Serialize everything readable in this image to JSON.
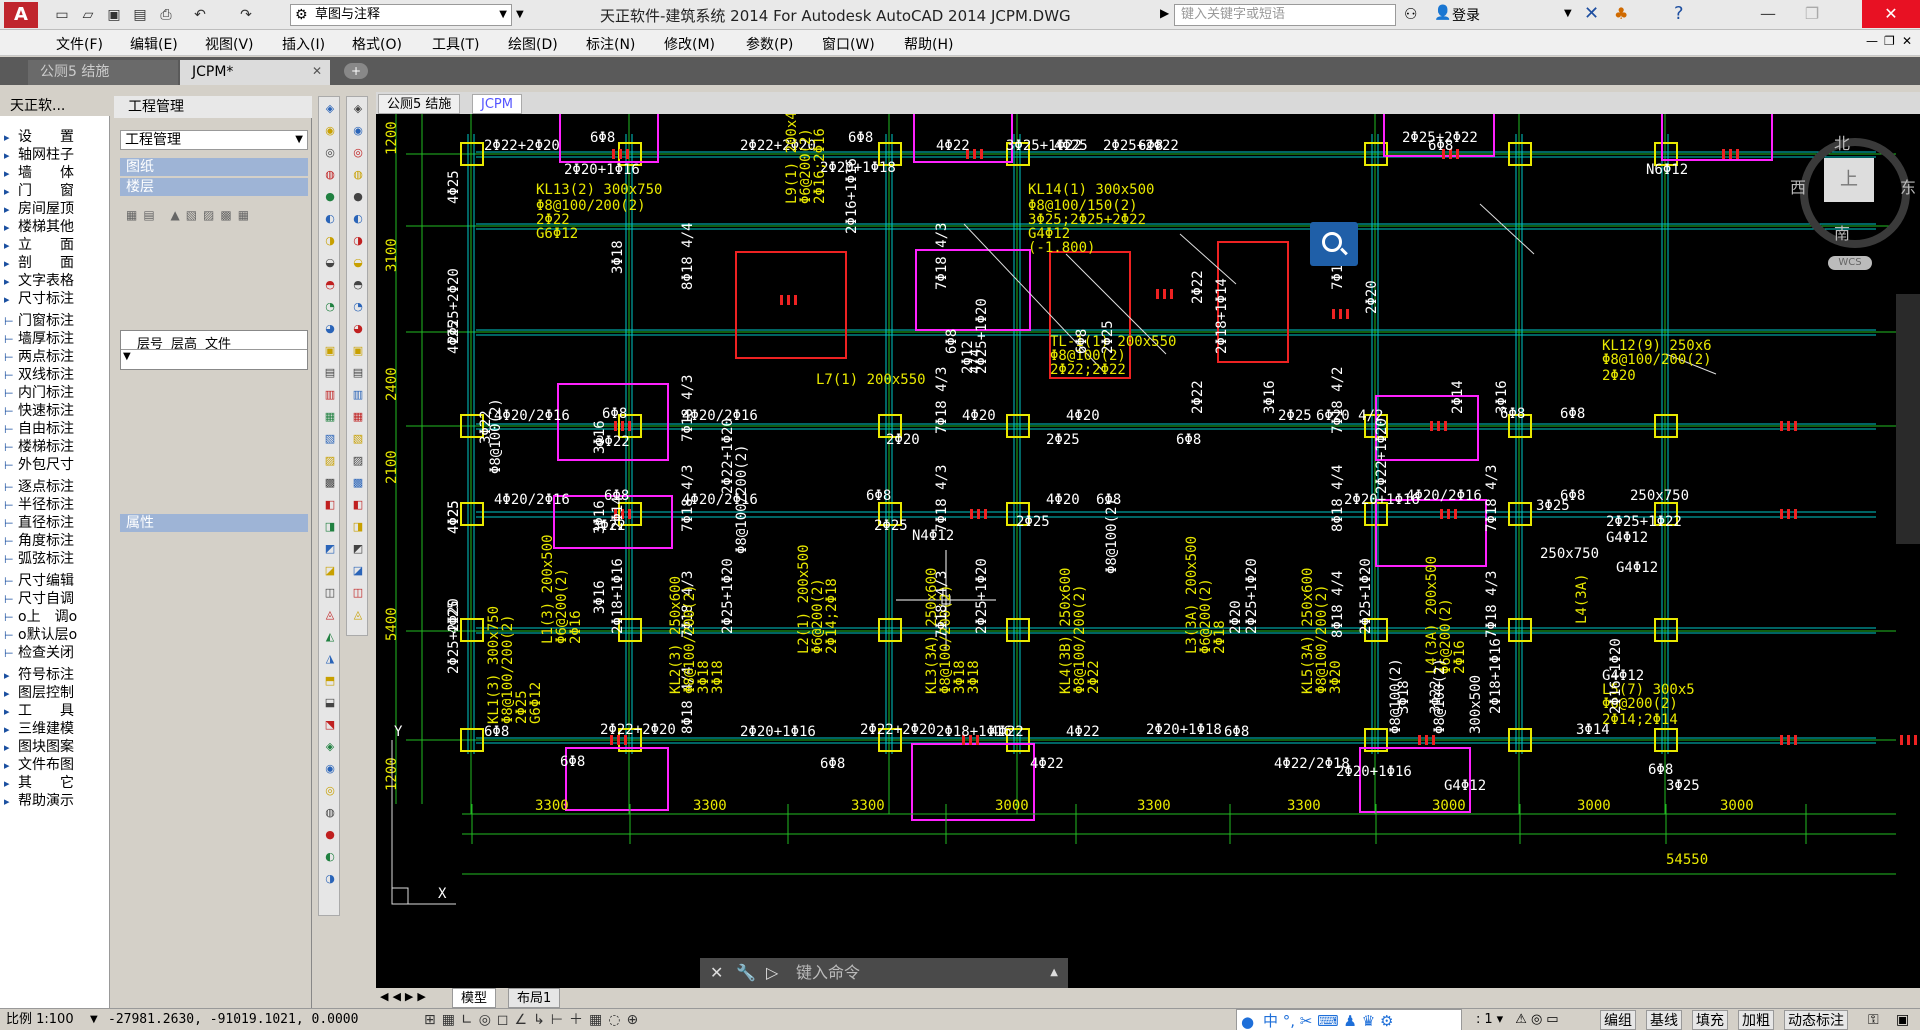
{
  "app": {
    "title": "天正软件-建筑系统 2014  For Autodesk AutoCAD 2014    JCPM.DWG",
    "logo": "A",
    "workspace": "草图与注释",
    "search_placeholder": "键入关键字或短语",
    "login": "登录"
  },
  "menu": [
    "文件(F)",
    "编辑(E)",
    "视图(V)",
    "插入(I)",
    "格式(O)",
    "工具(T)",
    "绘图(D)",
    "标注(N)",
    "修改(M)",
    "参数(P)",
    "窗口(W)",
    "帮助(H)"
  ],
  "file_tabs": [
    "公厕5 结施",
    "JCPM*"
  ],
  "left_panel": {
    "title": "天正软...",
    "items": [
      "设　　置",
      "轴网柱子",
      "墙　　体",
      "门　　窗",
      "房间屋顶",
      "楼梯其他",
      "立　　面",
      "剖　　面",
      "文字表格",
      "尺寸标注",
      "门窗标注",
      "墙厚标注",
      "两点标注",
      "双线标注",
      "内门标注",
      "快速标注",
      "自由标注",
      "楼梯标注",
      "外包尺寸",
      "逐点标注",
      "半径标注",
      "直径标注",
      "角度标注",
      "弧弦标注",
      "尺寸编辑",
      "尺寸自调",
      "o上　调o",
      "o默认层o",
      "检查关闭",
      "符号标注",
      "图层控制",
      "工　　具",
      "三维建模",
      "图块图案",
      "文件布图",
      "其　　它",
      "帮助演示"
    ]
  },
  "project_panel": {
    "title": "工程管理",
    "select": "工程管理",
    "sections": [
      "图纸",
      "楼层",
      "属性"
    ],
    "table_headers": [
      "层号",
      "层高",
      "文件"
    ]
  },
  "drawing_tabs": [
    "公厕5 结施",
    "JCPM"
  ],
  "compass": {
    "north": "北",
    "south": "南",
    "east": "东",
    "west": "西",
    "top": "上",
    "wcs": "WCS"
  },
  "axis": {
    "x": "X",
    "y": "Y"
  },
  "dims_bottom": [
    "3300",
    "3300",
    "3300",
    "3000",
    "3300",
    "3300",
    "3000",
    "3000",
    "3000"
  ],
  "dim_total": "54550",
  "dims_left": [
    "1200",
    "3100",
    "2400",
    "2100",
    "5400",
    "1200"
  ],
  "labels": [
    {
      "t": "2Φ22+2Φ20",
      "k": "w"
    },
    {
      "t": "6Φ8",
      "k": "w"
    },
    {
      "t": "2Φ20+1Φ16",
      "k": "w"
    },
    {
      "t": "2Φ22+2Φ20",
      "k": "w"
    },
    {
      "t": "6Φ8",
      "k": "w"
    },
    {
      "t": "2Φ20+1Φ18",
      "k": "w"
    },
    {
      "t": "4Φ22",
      "k": "w"
    },
    {
      "t": "3Φ25+1Φ22",
      "k": "w"
    },
    {
      "t": "4Φ25",
      "k": "w"
    },
    {
      "t": "2Φ25+2Φ22",
      "k": "w"
    },
    {
      "t": "6Φ8",
      "k": "w"
    },
    {
      "t": "2Φ25+2Φ22",
      "k": "w"
    },
    {
      "t": "6Φ8",
      "k": "w"
    },
    {
      "t": "N6Φ12",
      "k": "w"
    },
    {
      "t": "KL13(2) 300x750",
      "k": "y"
    },
    {
      "t": "Φ8@100/200(2)",
      "k": "y"
    },
    {
      "t": "2Φ22",
      "k": "y"
    },
    {
      "t": "G6Φ12",
      "k": "y"
    },
    {
      "t": "KL14(1) 300x500",
      "k": "y"
    },
    {
      "t": "Φ8@100/150(2)",
      "k": "y"
    },
    {
      "t": "3Φ25;2Φ25+2Φ22",
      "k": "y"
    },
    {
      "t": "G4Φ12",
      "k": "y"
    },
    {
      "t": "(-1.800)",
      "k": "y"
    },
    {
      "t": "L7(1) 200x550",
      "k": "y"
    },
    {
      "t": "TL-1(1) 200x550",
      "k": "y"
    },
    {
      "t": "Φ8@100(2)",
      "k": "y"
    },
    {
      "t": "2Φ22;2Φ22",
      "k": "y"
    },
    {
      "t": "KL12(9) 250x6",
      "k": "y"
    },
    {
      "t": "Φ8@100/200(2)",
      "k": "y"
    },
    {
      "t": "2Φ20",
      "k": "y"
    },
    {
      "t": "4Φ20/2Φ16",
      "k": "w"
    },
    {
      "t": "6Φ8",
      "k": "w"
    },
    {
      "t": "3Φ22",
      "k": "w"
    },
    {
      "t": "4Φ20/2Φ16",
      "k": "w"
    },
    {
      "t": "2Φ20",
      "k": "w"
    },
    {
      "t": "4Φ20",
      "k": "w"
    },
    {
      "t": "2Φ25",
      "k": "w"
    },
    {
      "t": "4Φ20",
      "k": "w"
    },
    {
      "t": "6Φ8",
      "k": "w"
    },
    {
      "t": "2Φ25",
      "k": "w"
    },
    {
      "t": "6Φ20 4/2",
      "k": "w"
    },
    {
      "t": "6Φ8",
      "k": "w"
    },
    {
      "t": "6Φ8",
      "k": "w"
    },
    {
      "t": "4Φ20/2Φ16",
      "k": "w"
    },
    {
      "t": "6Φ8",
      "k": "w"
    },
    {
      "t": "3Φ22",
      "k": "w"
    },
    {
      "t": "4Φ20/2Φ16",
      "k": "w"
    },
    {
      "t": "6Φ8",
      "k": "w"
    },
    {
      "t": "2Φ25",
      "k": "w"
    },
    {
      "t": "N4Φ12",
      "k": "w"
    },
    {
      "t": "2Φ25",
      "k": "w"
    },
    {
      "t": "4Φ20",
      "k": "w"
    },
    {
      "t": "6Φ8",
      "k": "w"
    },
    {
      "t": "2Φ20+1Φ16",
      "k": "w"
    },
    {
      "t": "4Φ20/2Φ16",
      "k": "w"
    },
    {
      "t": "6Φ8",
      "k": "w"
    },
    {
      "t": "2Φ25+1Φ22",
      "k": "w"
    },
    {
      "t": "G4Φ12",
      "k": "w"
    },
    {
      "t": "250x750",
      "k": "w"
    },
    {
      "t": "3Φ25",
      "k": "w"
    },
    {
      "t": "G4Φ12",
      "k": "w"
    },
    {
      "t": "250x750",
      "k": "w"
    },
    {
      "t": "6Φ8",
      "k": "w"
    },
    {
      "t": "2Φ22+2Φ20",
      "k": "w"
    },
    {
      "t": "6Φ8",
      "k": "w"
    },
    {
      "t": "2Φ20+1Φ16",
      "k": "w"
    },
    {
      "t": "2Φ22+2Φ20",
      "k": "w"
    },
    {
      "t": "6Φ8",
      "k": "w"
    },
    {
      "t": "2Φ18+1Φ16",
      "k": "w"
    },
    {
      "t": "4Φ22",
      "k": "w"
    },
    {
      "t": "4Φ22",
      "k": "w"
    },
    {
      "t": "4Φ22",
      "k": "w"
    },
    {
      "t": "2Φ20+1Φ18",
      "k": "w"
    },
    {
      "t": "6Φ8",
      "k": "w"
    },
    {
      "t": "4Φ22/2Φ18",
      "k": "w"
    },
    {
      "t": "2Φ20+1Φ16",
      "k": "w"
    },
    {
      "t": "G4Φ12",
      "k": "w"
    },
    {
      "t": "3Φ14",
      "k": "w"
    },
    {
      "t": "6Φ8",
      "k": "w"
    },
    {
      "t": "3Φ25",
      "k": "w"
    },
    {
      "t": "G4Φ12",
      "k": "w"
    },
    {
      "t": "L5(7) 300x5",
      "k": "y"
    },
    {
      "t": "Φ6@200(2)",
      "k": "y"
    },
    {
      "t": "2Φ14;2Φ14",
      "k": "y"
    },
    {
      "t": "G4Φ12",
      "k": "y"
    }
  ],
  "vlabels": [
    {
      "t": "4Φ25",
      "k": "w"
    },
    {
      "t": "2Φ25+2Φ20",
      "k": "w"
    },
    {
      "t": "4Φ25",
      "k": "w"
    },
    {
      "t": "3Φ22",
      "k": "w"
    },
    {
      "t": "Φ8@100(2)",
      "k": "w"
    },
    {
      "t": "4Φ25",
      "k": "w"
    },
    {
      "t": "4Φ25",
      "k": "w"
    },
    {
      "t": "2Φ25+2Φ20",
      "k": "w"
    },
    {
      "t": "4Φ25",
      "k": "w"
    },
    {
      "t": "3Φ18",
      "k": "w"
    },
    {
      "t": "3Φ16",
      "k": "w"
    },
    {
      "t": "3Φ16",
      "k": "w"
    },
    {
      "t": "2Φ14",
      "k": "w"
    },
    {
      "t": "3Φ16",
      "k": "w"
    },
    {
      "t": "2Φ18+1Φ16",
      "k": "w"
    },
    {
      "t": "8Φ18 4/4",
      "k": "w"
    },
    {
      "t": "7Φ18 4/3",
      "k": "w"
    },
    {
      "t": "7Φ18 4/3",
      "k": "w"
    },
    {
      "t": "7Φ18 4/3",
      "k": "w"
    },
    {
      "t": "8Φ18 4/4",
      "k": "w"
    },
    {
      "t": "2Φ22+1Φ20",
      "k": "w"
    },
    {
      "t": "2Φ25+1Φ20",
      "k": "w"
    },
    {
      "t": "Φ8@100/200(2)",
      "k": "w"
    },
    {
      "t": "2Φ16+1Φ16",
      "k": "w"
    },
    {
      "t": "L9(1) 200x400",
      "k": "y"
    },
    {
      "t": "Φ6@200(2)",
      "k": "y"
    },
    {
      "t": "2Φ16;2Φ16",
      "k": "y"
    },
    {
      "t": "L1(3) 200x500",
      "k": "y"
    },
    {
      "t": "Φ6@200(2)",
      "k": "y"
    },
    {
      "t": "2Φ16",
      "k": "y"
    },
    {
      "t": "KL1(3) 300x750",
      "k": "y"
    },
    {
      "t": "Φ8@100/200(2)",
      "k": "y"
    },
    {
      "t": "2Φ25",
      "k": "y"
    },
    {
      "t": "G6Φ12",
      "k": "y"
    },
    {
      "t": "KL2(3) 250x600",
      "k": "y"
    },
    {
      "t": "Φ8@100/200(2)",
      "k": "y"
    },
    {
      "t": "3Φ18",
      "k": "y"
    },
    {
      "t": "3Φ18",
      "k": "y"
    },
    {
      "t": "L2(1) 200x500",
      "k": "y"
    },
    {
      "t": "Φ6@200(2)",
      "k": "y"
    },
    {
      "t": "2Φ14;2Φ18",
      "k": "y"
    },
    {
      "t": "KL3(3A) 250x600",
      "k": "y"
    },
    {
      "t": "Φ8@100/200(2)",
      "k": "y"
    },
    {
      "t": "3Φ18",
      "k": "y"
    },
    {
      "t": "3Φ18",
      "k": "y"
    },
    {
      "t": "KL4(3B) 250x600",
      "k": "y"
    },
    {
      "t": "Φ8@100/200(2)",
      "k": "y"
    },
    {
      "t": "2Φ22",
      "k": "y"
    },
    {
      "t": "L3(3A) 200x500",
      "k": "y"
    },
    {
      "t": "Φ6@200(2)",
      "k": "y"
    },
    {
      "t": "2Φ18",
      "k": "y"
    },
    {
      "t": "KL5(3A) 250x600",
      "k": "y"
    },
    {
      "t": "Φ8@100/200(2)",
      "k": "y"
    },
    {
      "t": "3Φ20",
      "k": "y"
    },
    {
      "t": "L4(3A) 200x500",
      "k": "y"
    },
    {
      "t": "Φ6@200(2)",
      "k": "y"
    },
    {
      "t": "2Φ16",
      "k": "y"
    },
    {
      "t": "L4(3A)",
      "k": "y"
    },
    {
      "t": "7Φ18 4/3",
      "k": "w"
    },
    {
      "t": "7Φ18 4/3",
      "k": "w"
    },
    {
      "t": "7Φ18 4/3",
      "k": "w"
    },
    {
      "t": "7Φ18 4/3",
      "k": "w"
    },
    {
      "t": "7Φ18 4/2",
      "k": "w"
    },
    {
      "t": "8Φ18 4/4",
      "k": "w"
    },
    {
      "t": "8Φ18 4/4",
      "k": "w"
    },
    {
      "t": "7Φ18 4/3",
      "k": "w"
    },
    {
      "t": "7Φ18 4/3",
      "k": "w"
    },
    {
      "t": "7Φ18 4/3",
      "k": "w"
    },
    {
      "t": "2Φ25+1Φ20",
      "k": "w"
    },
    {
      "t": "2Φ25+1Φ20",
      "k": "w"
    },
    {
      "t": "2Φ25+1Φ20",
      "k": "w"
    },
    {
      "t": "2Φ25+1Φ20",
      "k": "w"
    },
    {
      "t": "2Φ18+1Φ16",
      "k": "w"
    },
    {
      "t": "2Φ16+1Φ20",
      "k": "w"
    },
    {
      "t": "2Φ22",
      "k": "w"
    },
    {
      "t": "2Φ22",
      "k": "w"
    },
    {
      "t": "3Φ16",
      "k": "w"
    },
    {
      "t": "2Φ14",
      "k": "w"
    },
    {
      "t": "3Φ16",
      "k": "w"
    },
    {
      "t": "2Φ20",
      "k": "w"
    },
    {
      "t": "2Φ20",
      "k": "w"
    },
    {
      "t": "Φ8@100(2)",
      "k": "w"
    },
    {
      "t": "Φ8@100(2)",
      "k": "w"
    },
    {
      "t": "Φ8@100(2)",
      "k": "w"
    },
    {
      "t": "300x500",
      "k": "w"
    },
    {
      "t": "2Φ18+1Φ14",
      "k": "w"
    },
    {
      "t": "2Φ22+1Φ20",
      "k": "w"
    },
    {
      "t": "6Φ8",
      "k": "w"
    },
    {
      "t": "6Φ8",
      "k": "w"
    },
    {
      "t": "2Φ12",
      "k": "w"
    },
    {
      "t": "4/4",
      "k": "w"
    },
    {
      "t": "2Φ25",
      "k": "w"
    },
    {
      "t": "3Φ18",
      "k": "w"
    },
    {
      "t": "3Φ22",
      "k": "w"
    }
  ],
  "command": {
    "placeholder": "键入命令"
  },
  "layout_tabs": [
    "模型",
    "布局1"
  ],
  "status": {
    "scale": "比例 1:100",
    "coords": "-27981.2630, -91019.1021, 0.0000",
    "right_items": [
      "编组",
      "基线",
      "填充",
      "加粗",
      "动态标注"
    ]
  }
}
